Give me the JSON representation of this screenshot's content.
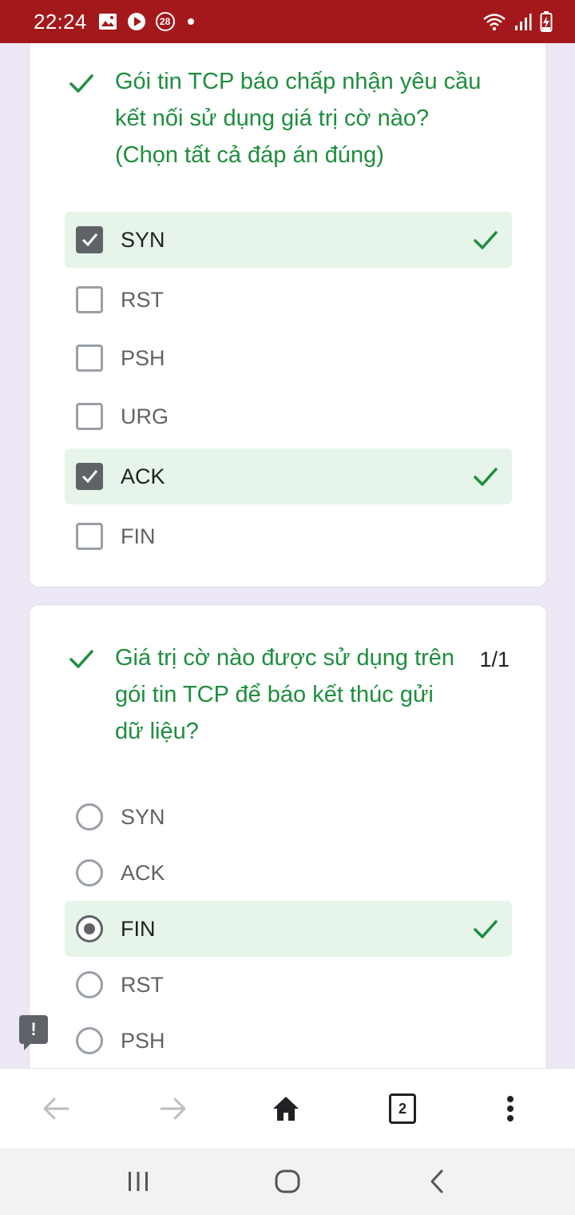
{
  "status_bar": {
    "time": "22:24",
    "notification_count": "28",
    "background": "#a3191b"
  },
  "question1": {
    "title_lines": [
      "Gói tin TCP báo chấp nhận yêu cầu",
      "kết nối sử dụng giá trị cờ nào?",
      "(Chọn tất cả đáp án đúng)"
    ],
    "options": [
      {
        "label": "SYN",
        "checked": true,
        "correct": true
      },
      {
        "label": "RST",
        "checked": false,
        "correct": false
      },
      {
        "label": "PSH",
        "checked": false,
        "correct": false
      },
      {
        "label": "URG",
        "checked": false,
        "correct": false
      },
      {
        "label": "ACK",
        "checked": true,
        "correct": true
      },
      {
        "label": "FIN",
        "checked": false,
        "correct": false
      }
    ]
  },
  "question2": {
    "title_lines": [
      "Giá trị cờ nào được sử dụng trên",
      "gói tin TCP để báo kết thúc gửi",
      "dữ liệu?"
    ],
    "score": "1/1",
    "options": [
      {
        "label": "SYN",
        "checked": false,
        "correct": false
      },
      {
        "label": "ACK",
        "checked": false,
        "correct": false
      },
      {
        "label": "FIN",
        "checked": true,
        "correct": true
      },
      {
        "label": "RST",
        "checked": false,
        "correct": false
      },
      {
        "label": "PSH",
        "checked": false,
        "correct": false
      }
    ]
  },
  "browser_toolbar": {
    "tab_count": "2"
  },
  "colors": {
    "correct_green": "#1e8e3e",
    "selected_bg": "#e6f4ea",
    "page_bg": "#ede7f6"
  }
}
